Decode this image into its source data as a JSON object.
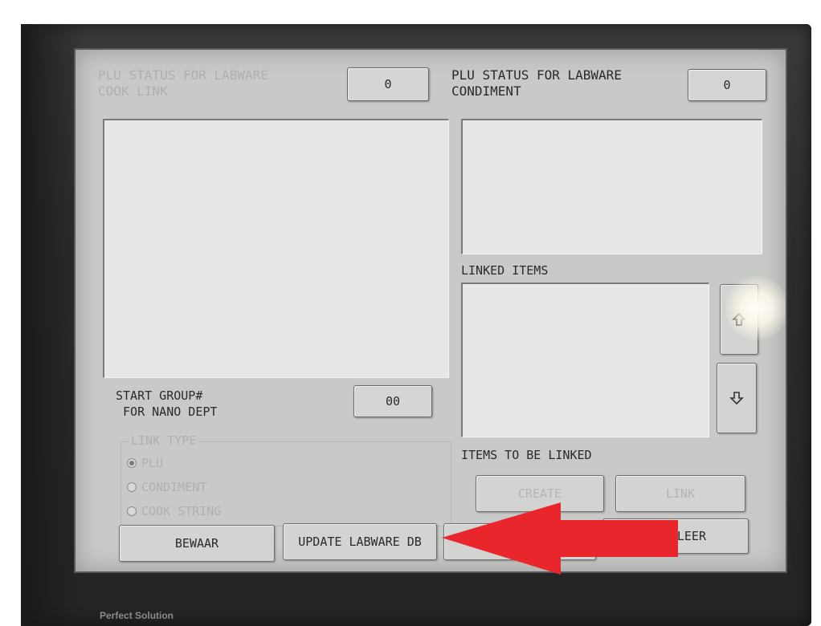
{
  "top_left": {
    "title_line1": "PLU STATUS FOR LABWARE",
    "title_line2": "COOK LINK",
    "count": "0"
  },
  "top_right": {
    "title_line1": "PLU STATUS FOR LABWARE",
    "title_line2": "CONDIMENT",
    "count": "0"
  },
  "linked_items_label": "LINKED ITEMS",
  "items_to_be_linked_label": "ITEMS TO BE LINKED",
  "start_group": {
    "label_line1": "START GROUP#",
    "label_line2": " FOR NANO DEPT",
    "value": "00"
  },
  "link_type": {
    "legend": "LINK TYPE",
    "options": [
      {
        "label": "PLU",
        "selected": true
      },
      {
        "label": "CONDIMENT",
        "selected": false
      },
      {
        "label": "COOK STRING",
        "selected": false
      }
    ]
  },
  "buttons": {
    "create": "CREATE",
    "link": "LINK",
    "bewaar": "BEWAAR",
    "update_labware_db": "UPDATE LABWARE DB",
    "right_partial": "LEER"
  },
  "device_label": "Perfect Solution",
  "colors": {
    "screen_bg": "#c8cac8",
    "panel_bg": "#e6e8e6",
    "annotation_arrow": "#e8262b"
  },
  "icons": {
    "scroll_up": "arrow-up-icon",
    "scroll_down": "arrow-down-icon"
  }
}
